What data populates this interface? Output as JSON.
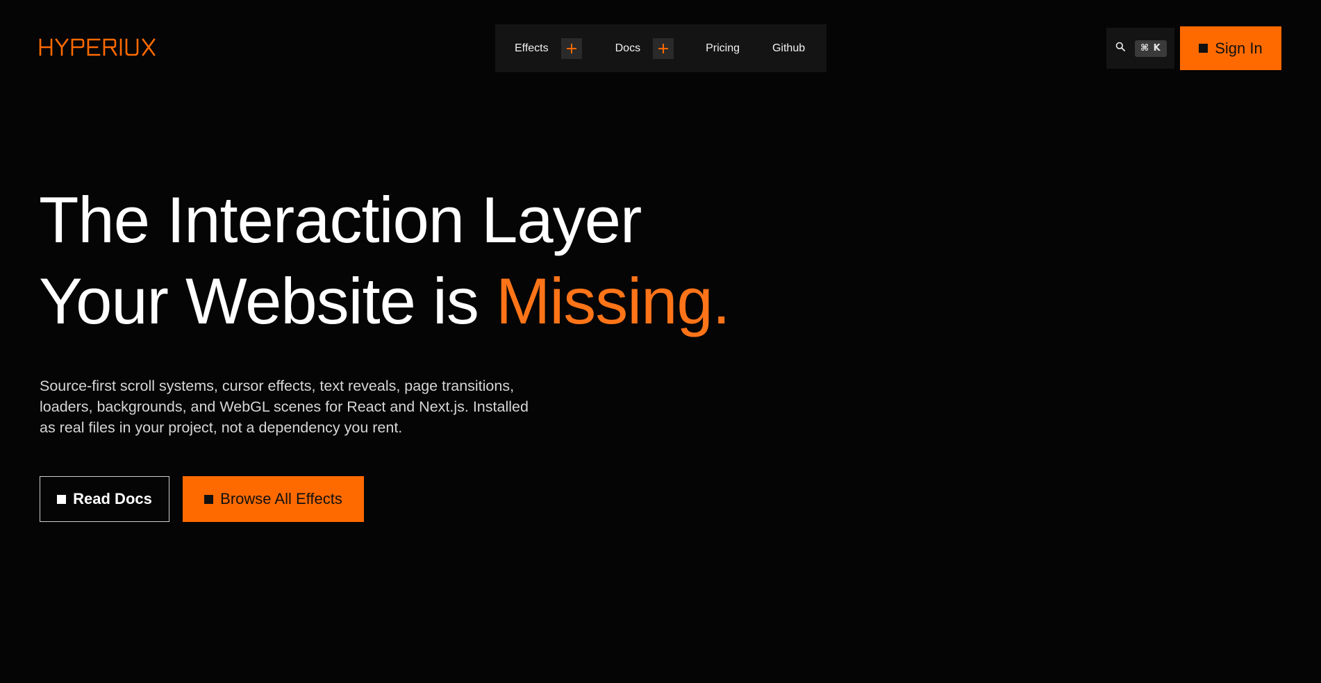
{
  "brand": {
    "logo_text": "HYPERIUX",
    "accent_color": "#ff6a00",
    "background_color": "#050505"
  },
  "nav": {
    "items": [
      {
        "label": "Effects",
        "has_expand": true
      },
      {
        "label": "Docs",
        "has_expand": true
      },
      {
        "label": "Pricing",
        "has_expand": false
      },
      {
        "label": "Github",
        "has_expand": false
      }
    ]
  },
  "search": {
    "icon": "search-icon",
    "shortcut": "⌘ K"
  },
  "header": {
    "sign_in_label": "Sign In"
  },
  "hero": {
    "title_line1": "The Interaction Layer",
    "title_line2_prefix": "Your Website is ",
    "title_line2_accent": "Missing.",
    "description_line1": "Source-first scroll systems, cursor effects, text reveals, page transitions,",
    "description_line2": "loaders, backgrounds, and WebGL scenes for React and Next.js. Installed",
    "description_line3": "as real files in your project, not a dependency you rent.",
    "primary_cta": "Browse All Effects",
    "secondary_cta": "Read Docs"
  }
}
